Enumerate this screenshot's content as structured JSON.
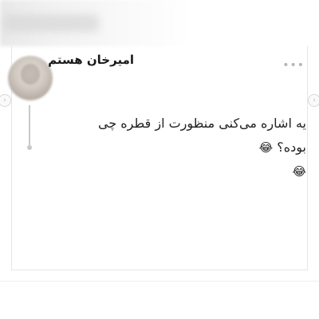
{
  "post": {
    "username": "امیرخان هستم",
    "text": "یه اشاره می‌کنی منظورت از قطره چی بوده؟",
    "emoji_inline": "😂",
    "emoji_trailing": "😂"
  },
  "icons": {
    "more": "more-horizontal-icon",
    "prev": "chevron-left-icon",
    "next": "chevron-right-icon"
  },
  "colors": {
    "text": "#222222",
    "username": "#1a1a1a",
    "muted": "#b5b5b5"
  }
}
